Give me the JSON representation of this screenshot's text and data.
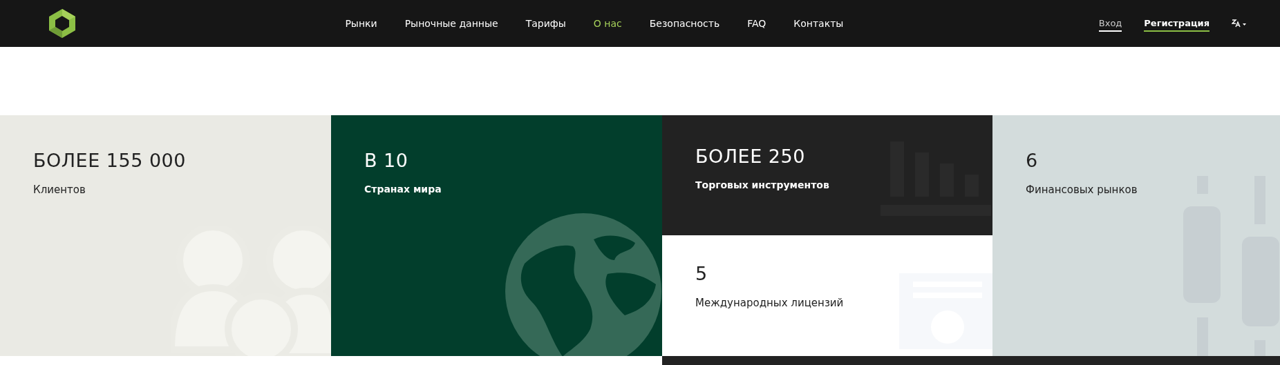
{
  "nav": {
    "links": [
      {
        "label": "Рынки",
        "selected": false
      },
      {
        "label": "Рыночные данные",
        "selected": false
      },
      {
        "label": "Тарифы",
        "selected": false
      },
      {
        "label": "О нас",
        "selected": true
      },
      {
        "label": "Безопасность",
        "selected": false
      },
      {
        "label": "FAQ",
        "selected": false
      },
      {
        "label": "Контакты",
        "selected": false
      }
    ],
    "login": "Вход",
    "register": "Регистрация"
  },
  "stats": [
    {
      "kind": "people",
      "value": "БОЛЕЕ 155 000",
      "label": "Клиентов"
    },
    {
      "kind": "globe",
      "value": "В 10",
      "label": "Странах мира"
    },
    {
      "kind": "bars",
      "value": "БОЛЕЕ 250",
      "label": "Торговых инструментов"
    },
    {
      "kind": "certificate",
      "value": "5",
      "label": "Международных лицензий"
    },
    {
      "kind": "candles",
      "value": "6",
      "label": "Финансовых рынков"
    }
  ]
}
